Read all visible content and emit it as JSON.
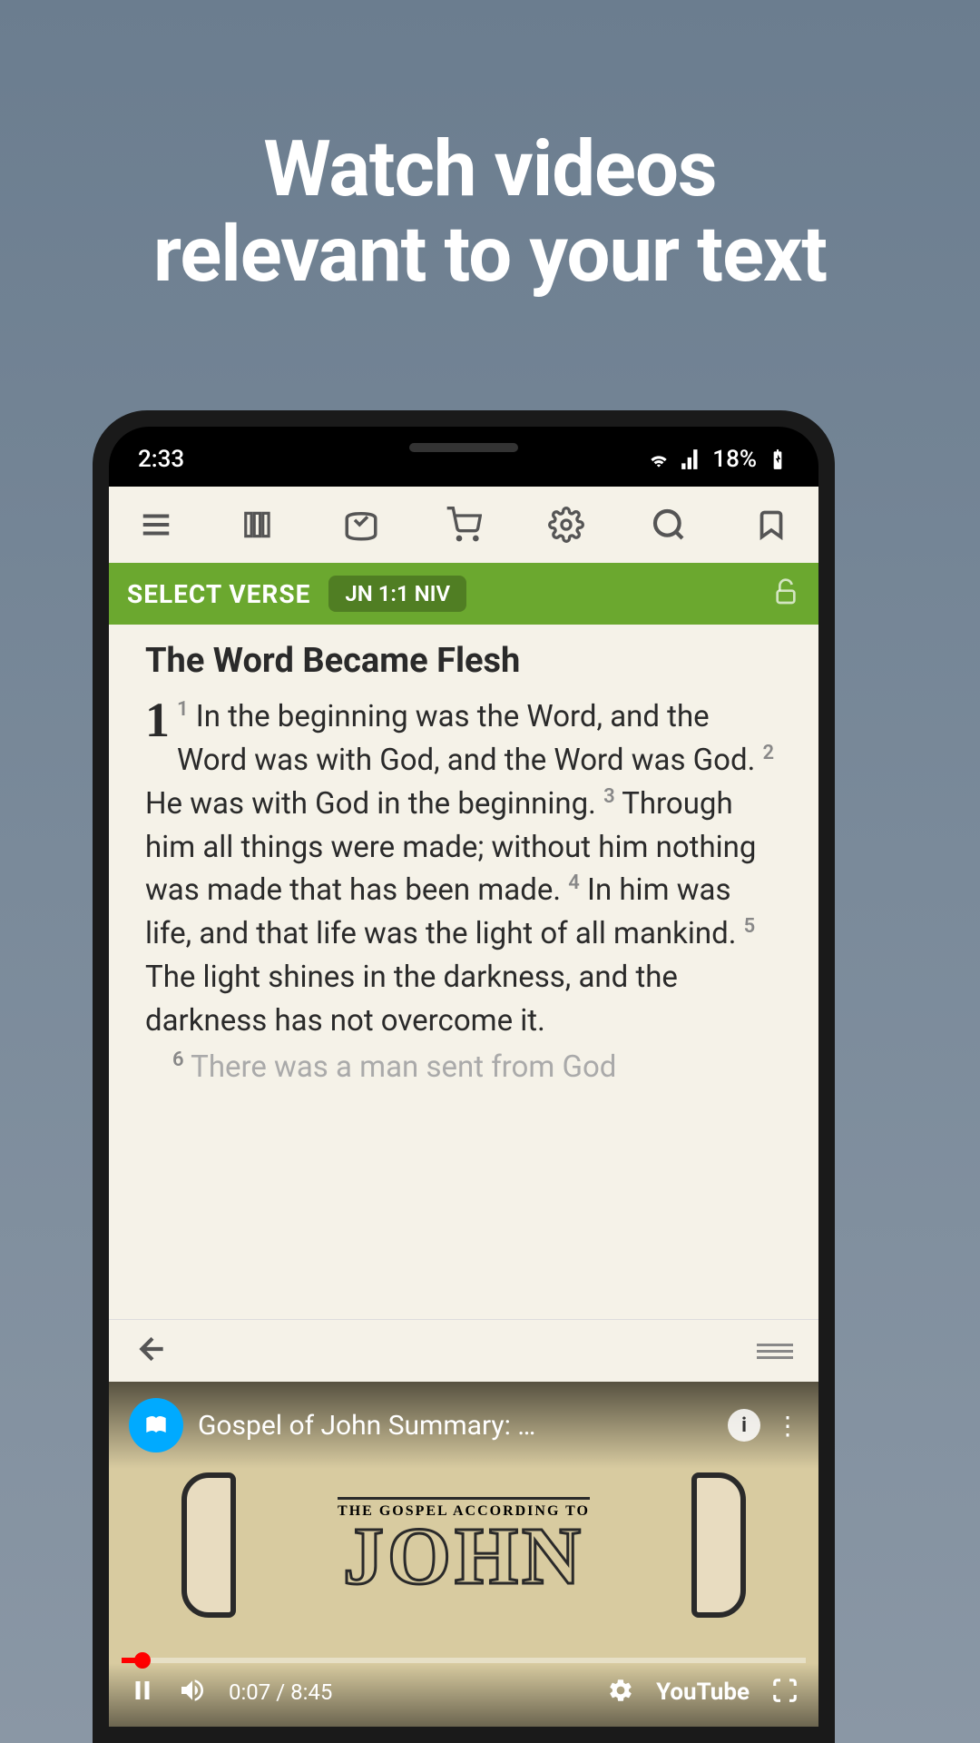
{
  "promo": {
    "headline_line1": "Watch videos",
    "headline_line2": "relevant to your text"
  },
  "status_bar": {
    "time": "2:33",
    "battery_text": "18%"
  },
  "verse_bar": {
    "select_label": "SELECT VERSE",
    "reference": "JN 1:1 NIV"
  },
  "content": {
    "section_title": "The Word Became Flesh",
    "chapter_number": "1",
    "verses": {
      "v1": "In the beginning was the Word, and the Word was with God, and the Word was God.",
      "v2": "He was with God in the beginning.",
      "v3": "Through him all things were made; without him nothing was made that has been made.",
      "v4": "In him was life, and that life was the light of all mankind.",
      "v5": "The light shines in the darkness, and the darkness has not overcome it.",
      "v6_partial": "There was a man sent from God"
    },
    "verse_nums": {
      "n1": "1",
      "n2": "2",
      "n3": "3",
      "n4": "4",
      "n5": "5",
      "n6": "6"
    }
  },
  "video": {
    "title": "Gospel of John Summary: …",
    "info_symbol": "i",
    "thumb_subtitle": "THE GOSPEL ACCORDING TO",
    "thumb_title": "JOHN",
    "current_time": "0:07",
    "duration": "8:45",
    "time_display": "0:07 / 8:45",
    "youtube_label": "YouTube"
  },
  "colors": {
    "accent_green": "#6ba82f",
    "progress_red": "#ff0000",
    "channel_blue": "#00aaff"
  }
}
